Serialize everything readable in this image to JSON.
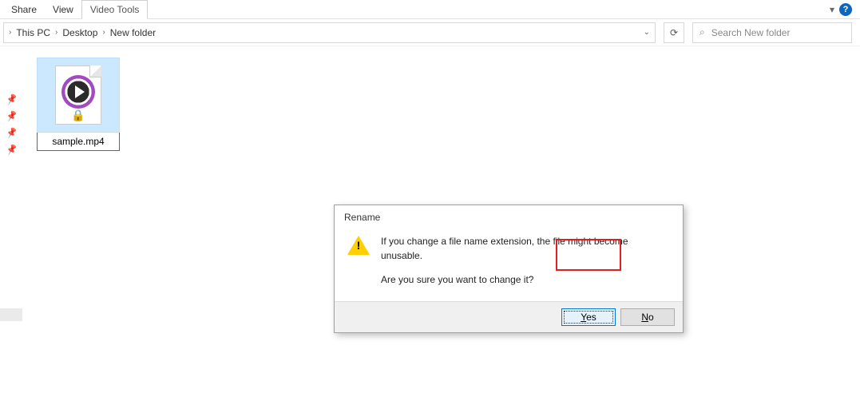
{
  "ribbon": {
    "tabs": [
      "Share",
      "View"
    ],
    "contextual_tab": "Video Tools",
    "help_label": "?"
  },
  "breadcrumb": {
    "items": [
      "This PC",
      "Desktop",
      "New folder"
    ]
  },
  "search": {
    "placeholder": "Search New folder"
  },
  "file": {
    "name": "sample.mp4",
    "lock_glyph": "🔒"
  },
  "dialog": {
    "title": "Rename",
    "line1": "If you change a file name extension, the file might become unusable.",
    "line2": "Are you sure you want to change it?",
    "yes_prefix": "Y",
    "yes_rest": "es",
    "no_prefix": "N",
    "no_rest": "o"
  }
}
